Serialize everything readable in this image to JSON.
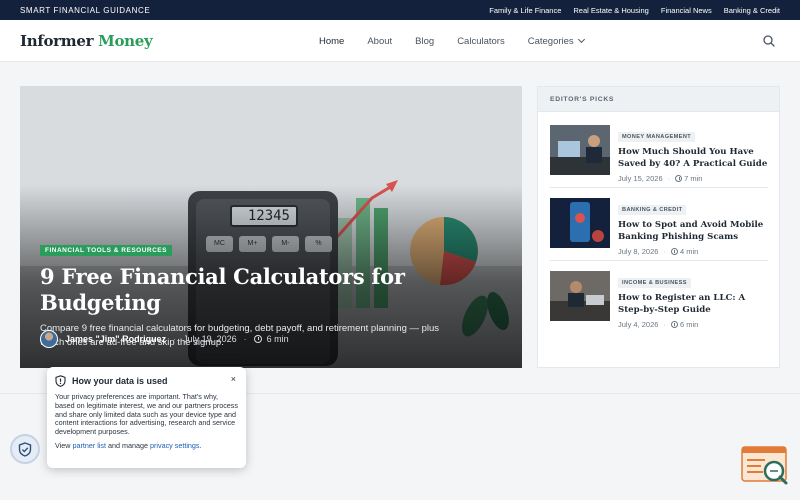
{
  "topbar": {
    "tagline": "SMART FINANCIAL GUIDANCE",
    "links": [
      "Family & Life Finance",
      "Real Estate & Housing",
      "Financial News",
      "Banking & Credit"
    ]
  },
  "header": {
    "logo_part1": "Informer",
    "logo_part2": "Money",
    "nav": {
      "home": "Home",
      "about": "About",
      "blog": "Blog",
      "calculators": "Calculators",
      "categories": "Categories"
    }
  },
  "hero": {
    "badge": "FINANCIAL TOOLS & RESOURCES",
    "title": "9 Free Financial Calculators for Budgeting",
    "excerpt": "Compare 9 free financial calculators for budgeting, debt payoff, and retirement planning — plus which ones are ad-free and skip the signup.",
    "author": "James \"Jim\" Rodriguez",
    "date": "July 19, 2026",
    "read_time": "6 min",
    "calc_display": "12345",
    "calc_keys": [
      "MC",
      "M+",
      "M-",
      "%"
    ]
  },
  "sidebar": {
    "heading": "EDITOR'S PICKS",
    "picks": [
      {
        "category": "MONEY MANAGEMENT",
        "title": "How Much Should You Have Saved by 40? A Practical Guide",
        "date": "July 15, 2026",
        "read_time": "7 min"
      },
      {
        "category": "BANKING & CREDIT",
        "title": "How to Spot and Avoid Mobile Banking Phishing Scams",
        "date": "July 8, 2026",
        "read_time": "4 min"
      },
      {
        "category": "INCOME & BUSINESS",
        "title": "How to Register an LLC: A Step-by-Step Guide",
        "date": "July 4, 2026",
        "read_time": "6 min"
      }
    ]
  },
  "privacy": {
    "title": "How your data is used",
    "close": "×",
    "body": "Your privacy preferences are important. That's why, based on legitimate interest, we and our partners process and share only limited data such as your device type and content interactions for advertising, research and service development purposes.",
    "view": "View",
    "partner_link": "partner list",
    "and_manage": "and manage",
    "settings_link": "privacy settings",
    "period": "."
  },
  "colors": {
    "topbar": "#14213d",
    "brand_green": "#2a9d5c",
    "link_blue": "#1a5fb4"
  }
}
